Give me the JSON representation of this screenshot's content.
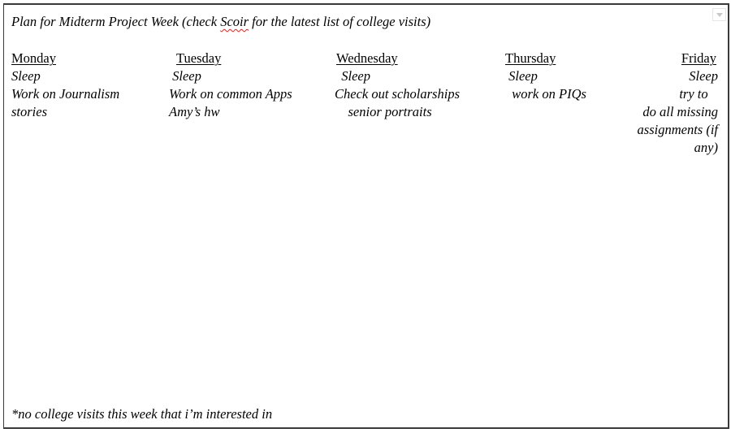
{
  "document": {
    "title_before": "Plan for Midterm Project Week (check ",
    "title_misspelled": "Scoir",
    "title_after": " for the latest list of college visits)",
    "days": [
      {
        "label": "Monday",
        "items": [
          "Sleep",
          "Work on Journalism",
          "stories"
        ]
      },
      {
        "label": "Tuesday",
        "items": [
          " Sleep",
          "Work on common Apps",
          "Amy’s hw"
        ]
      },
      {
        "label": "Wednesday",
        "items": [
          "  Sleep",
          "Check out scholarships",
          "    senior portraits"
        ]
      },
      {
        "label": "Thursday",
        "items": [
          " Sleep",
          "  work on PIQs"
        ]
      },
      {
        "label": "Friday",
        "items": [
          "Sleep",
          "try to   ",
          "do all missing",
          "assignments (if",
          "any)"
        ]
      }
    ],
    "footnote": "*no college visits this week that i’m interested in"
  },
  "controls": {
    "dropdown_icon": "chevron-down-icon"
  }
}
